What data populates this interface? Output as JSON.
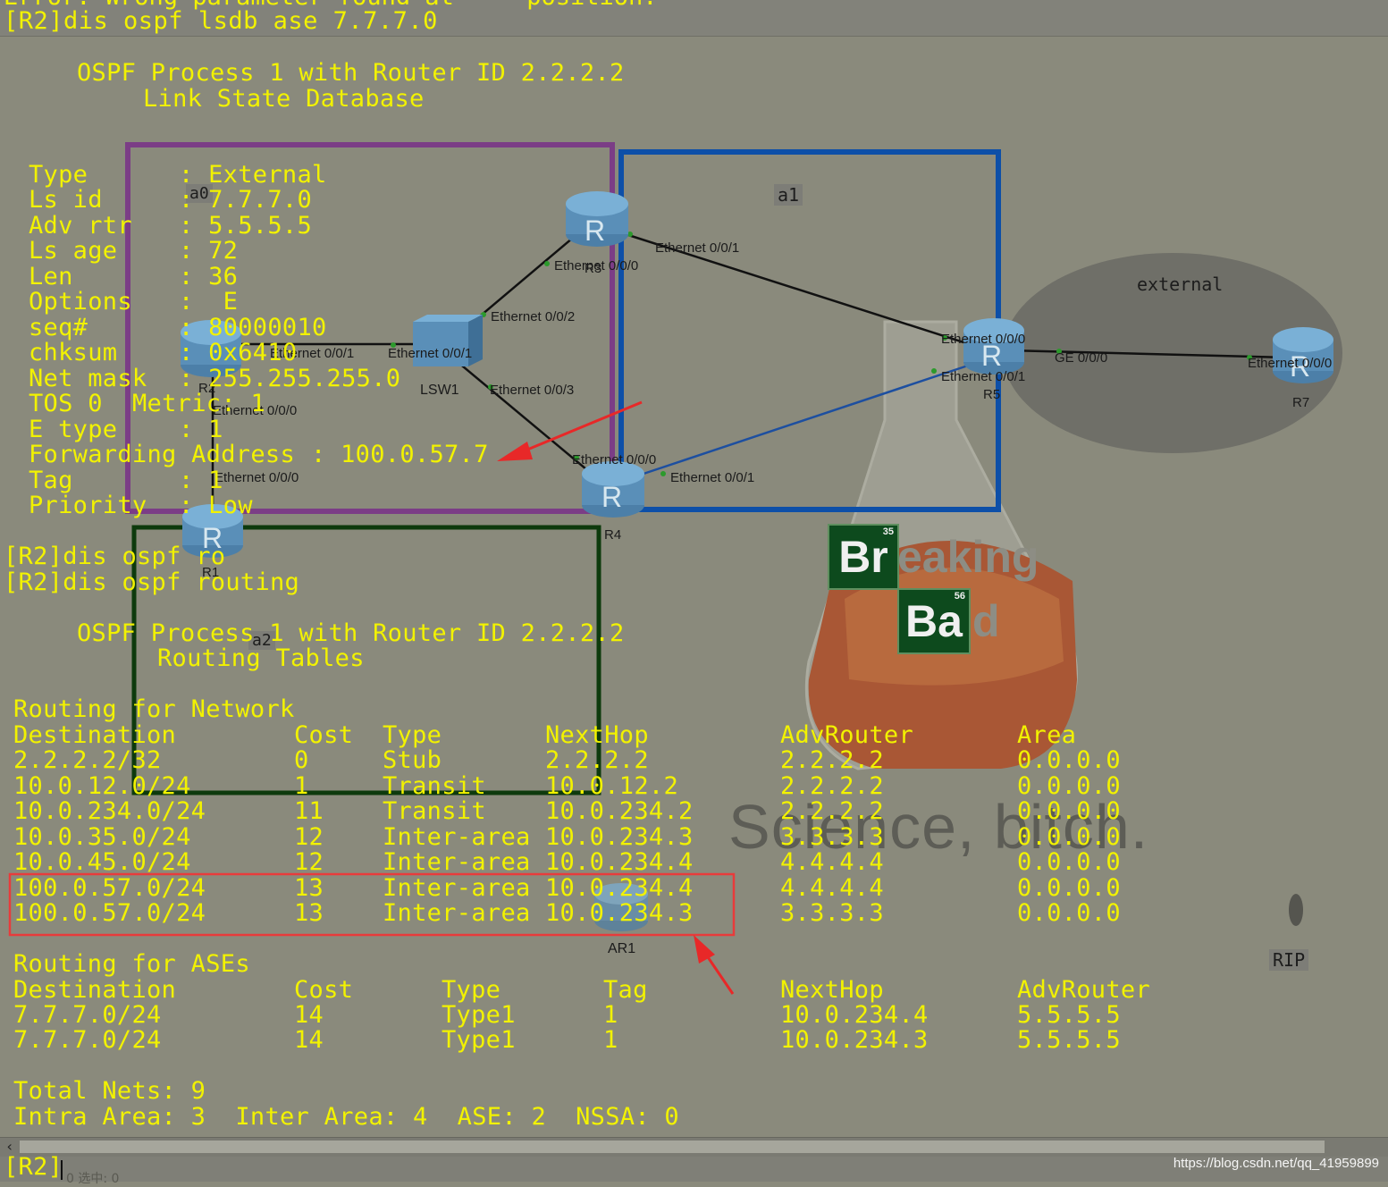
{
  "window": {
    "error_line": "Error: Wrong parameter found at '^' position.",
    "command": "[R2]dis ospf lsdb ase 7.7.7.0",
    "prompt": "[R2]",
    "status_hint": "0  选中: 0",
    "footer_url": "https://blog.csdn.net/qq_41959899"
  },
  "lsdb": {
    "header_line1": "OSPF Process 1 with Router ID 2.2.2.2",
    "header_line2": "Link State Database",
    "fields": [
      {
        "label": "Type",
        "value": ": External"
      },
      {
        "label": "Ls id",
        "value": ": 7.7.7.0"
      },
      {
        "label": "Adv rtr",
        "value": ": 5.5.5.5"
      },
      {
        "label": "Ls age",
        "value": ": 72"
      },
      {
        "label": "Len",
        "value": ": 36"
      },
      {
        "label": "Options",
        "value": ":  E"
      },
      {
        "label": "seq#",
        "value": ": 80000010"
      },
      {
        "label": "chksum",
        "value": ": 0x6410"
      },
      {
        "label": "Net mask",
        "value": ": 255.255.255.0"
      },
      {
        "label": "TOS 0",
        "value": "Metric: 1"
      },
      {
        "label": "E type",
        "value": ": 1"
      },
      {
        "label": "Forwarding Address",
        "value": ": 100.0.57.7"
      },
      {
        "label": "Tag",
        "value": ": 1"
      },
      {
        "label": "Priority",
        "value": ": Low"
      }
    ]
  },
  "commands": {
    "cmd1": "[R2]dis ospf ro",
    "cmd2": "[R2]dis ospf routing"
  },
  "routing": {
    "header_line1": "OSPF Process 1 with Router ID 2.2.2.2",
    "header_line2": "Routing Tables",
    "network_title": "Routing for Network",
    "network_columns": [
      "Destination",
      "Cost",
      "Type",
      "NextHop",
      "AdvRouter",
      "Area"
    ],
    "network_rows": [
      [
        "2.2.2.2/32",
        "0",
        "Stub",
        "2.2.2.2",
        "2.2.2.2",
        "0.0.0.0"
      ],
      [
        "10.0.12.0/24",
        "1",
        "Transit",
        "10.0.12.2",
        "2.2.2.2",
        "0.0.0.0"
      ],
      [
        "10.0.234.0/24",
        "11",
        "Transit",
        "10.0.234.2",
        "2.2.2.2",
        "0.0.0.0"
      ],
      [
        "10.0.35.0/24",
        "12",
        "Inter-area",
        "10.0.234.3",
        "3.3.3.3",
        "0.0.0.0"
      ],
      [
        "10.0.45.0/24",
        "12",
        "Inter-area",
        "10.0.234.4",
        "4.4.4.4",
        "0.0.0.0"
      ],
      [
        "100.0.57.0/24",
        "13",
        "Inter-area",
        "10.0.234.4",
        "4.4.4.4",
        "0.0.0.0"
      ],
      [
        "100.0.57.0/24",
        "13",
        "Inter-area",
        "10.0.234.3",
        "3.3.3.3",
        "0.0.0.0"
      ]
    ],
    "ase_title": "Routing for ASEs",
    "ase_columns": [
      "Destination",
      "Cost",
      "Type",
      "Tag",
      "NextHop",
      "AdvRouter"
    ],
    "ase_rows": [
      [
        "7.7.7.0/24",
        "14",
        "Type1",
        "1",
        "10.0.234.4",
        "5.5.5.5"
      ],
      [
        "7.7.7.0/24",
        "14",
        "Type1",
        "1",
        "10.0.234.3",
        "5.5.5.5"
      ]
    ],
    "total_line": "Total Nets: 9",
    "summary_line": "Intra Area: 3  Inter Area: 4  ASE: 2  NSSA: 0"
  },
  "topology": {
    "areas": [
      "a0",
      "a1",
      "a2",
      "external",
      "RIP"
    ],
    "devices": [
      "R1",
      "R2",
      "R3",
      "R4",
      "R5",
      "R7",
      "LSW1",
      "AR1"
    ],
    "ports": {
      "r2_e001": "Ethernet 0/0/1",
      "lsw_e001": "Ethernet 0/0/1",
      "lsw_e002": "Ethernet 0/0/2",
      "lsw_e003": "Ethernet 0/0/3",
      "r3_e000": "Ethernet 0/0/0",
      "r3_e001": "Ethernet 0/0/1",
      "r5_e000": "Ethernet 0/0/0",
      "r5_e001": "Ethernet 0/0/1",
      "r5_ge": "GE 0/0/0",
      "r7_e000": "Ethernet 0/0/0",
      "r4_e000": "Ethernet 0/0/0",
      "r4_e001": "Ethernet 0/0/1",
      "r2_e000": "Ethernet 0/0/0",
      "r1_e000": "Ethernet 0/0/0"
    }
  },
  "wallpaper": {
    "br": "Br",
    "num1": "35",
    "ba": "Ba",
    "num2": "56",
    "rest1": "eaking",
    "rest2": "d",
    "tagline": "Science, bitch."
  },
  "colors": {
    "terminal_text": "#f2f200",
    "area0_box": "#7b3d86",
    "area1_box": "#0d4fa8",
    "area2_box": "#0d3a0d",
    "highlight_box": "#e83b3b",
    "arrow": "#e82828"
  }
}
